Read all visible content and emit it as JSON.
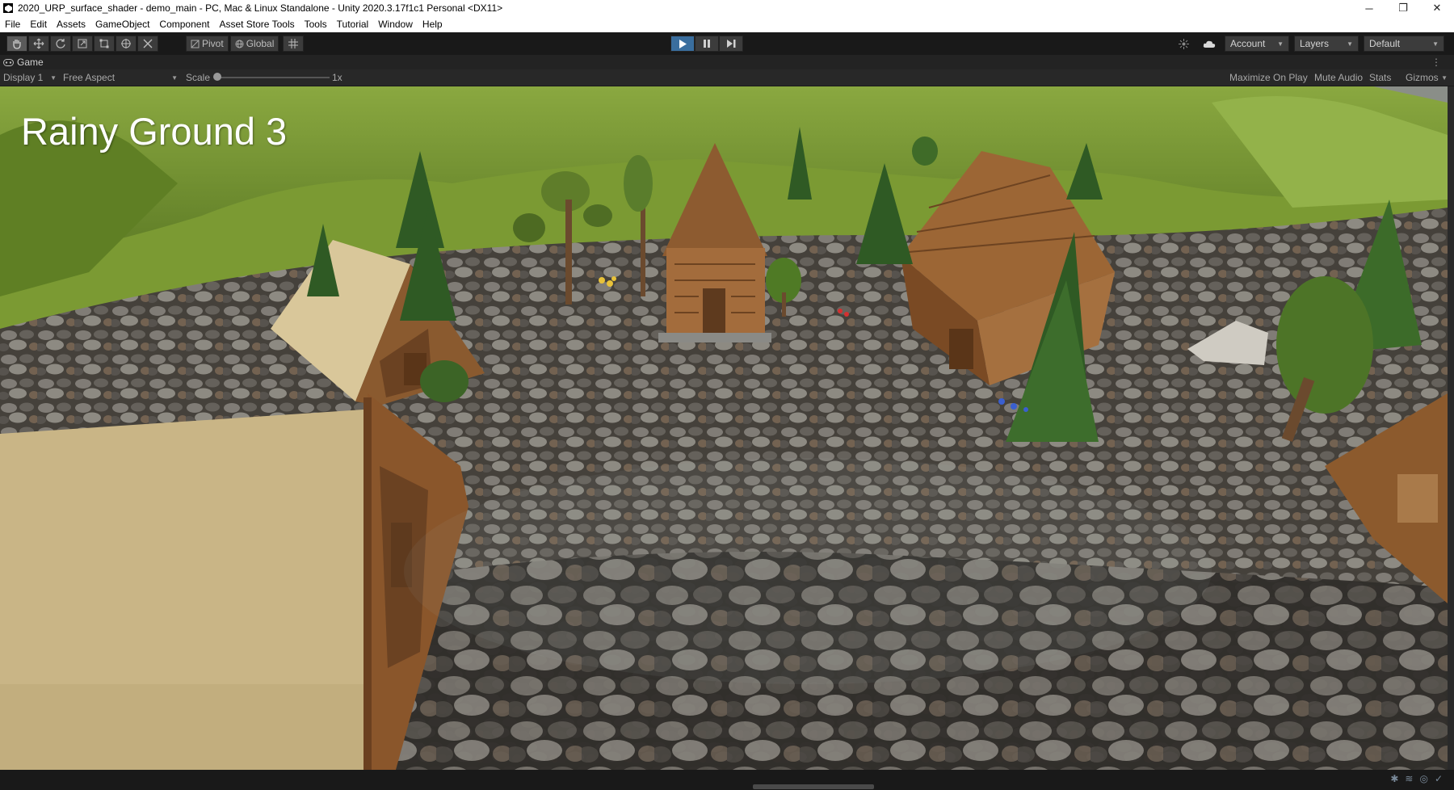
{
  "window": {
    "title": "2020_URP_surface_shader - demo_main - PC, Mac & Linux Standalone - Unity 2020.3.17f1c1 Personal <DX11>",
    "controls": {
      "minimize": "─",
      "restore": "❐",
      "close": "✕"
    }
  },
  "menu": [
    "File",
    "Edit",
    "Assets",
    "GameObject",
    "Component",
    "Asset Store Tools",
    "Tools",
    "Tutorial",
    "Window",
    "Help"
  ],
  "toolbar": {
    "transform_tools": [
      "hand-icon",
      "move-icon",
      "rotate-icon",
      "scale-icon",
      "rect-icon",
      "transform-icon",
      "custom-tool-icon"
    ],
    "pivot_label": "Pivot",
    "global_label": "Global",
    "playback": [
      "play-icon",
      "pause-icon",
      "step-icon"
    ],
    "account_label": "Account",
    "layers_label": "Layers",
    "layout_label": "Default"
  },
  "game_tab": {
    "label": "Game"
  },
  "game_bar": {
    "display": "Display 1",
    "aspect": "Free Aspect",
    "scale_label": "Scale",
    "scale_value": "1x",
    "scale_fraction": 0.0,
    "maximize": "Maximize On Play",
    "mute": "Mute Audio",
    "stats": "Stats",
    "gizmos": "Gizmos"
  },
  "scene": {
    "title": "Rainy Ground 3"
  },
  "colors": {
    "accent_play": "#3a6e9e",
    "panel_dark": "#191919",
    "grass": "#6f8f2e",
    "stone": "#5a5a5a"
  }
}
